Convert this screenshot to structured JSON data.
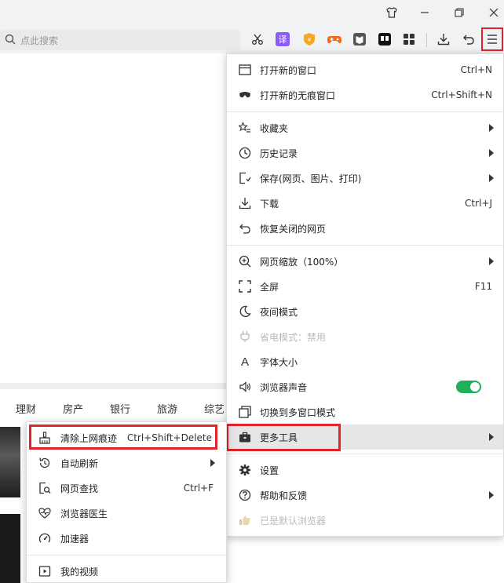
{
  "toolbar": {
    "search_placeholder": "点此搜索",
    "translate_label": "译"
  },
  "page": {
    "nav_items": [
      "理财",
      "房产",
      "银行",
      "旅游",
      "综艺"
    ]
  },
  "menu": {
    "items": [
      {
        "label": "打开新的窗口",
        "shortcut": "Ctrl+N"
      },
      {
        "label": "打开新的无痕窗口",
        "shortcut": "Ctrl+Shift+N"
      },
      {
        "label": "收藏夹"
      },
      {
        "label": "历史记录"
      },
      {
        "label": "保存(网页、图片、打印)"
      },
      {
        "label": "下载",
        "shortcut": "Ctrl+J"
      },
      {
        "label": "恢复关闭的网页"
      },
      {
        "label": "网页缩放（100%）"
      },
      {
        "label": "全屏",
        "shortcut": "F11"
      },
      {
        "label": "夜间模式"
      },
      {
        "label": "省电模式：禁用"
      },
      {
        "label": "字体大小"
      },
      {
        "label": "浏览器声音",
        "toggle_on": true
      },
      {
        "label": "切换到多窗口模式"
      },
      {
        "label": "更多工具"
      },
      {
        "label": "设置"
      },
      {
        "label": "帮助和反馈"
      },
      {
        "label": "已是默认浏览器"
      }
    ]
  },
  "submenu": {
    "items": [
      {
        "label": "清除上网痕迹",
        "shortcut": "Ctrl+Shift+Delete"
      },
      {
        "label": "自动刷新"
      },
      {
        "label": "网页查找",
        "shortcut": "Ctrl+F"
      },
      {
        "label": "浏览器医生"
      },
      {
        "label": "加速器"
      },
      {
        "label": "我的视频"
      }
    ]
  },
  "colors": {
    "highlight": "#e1232a",
    "toggle_on": "#1fb15a"
  }
}
